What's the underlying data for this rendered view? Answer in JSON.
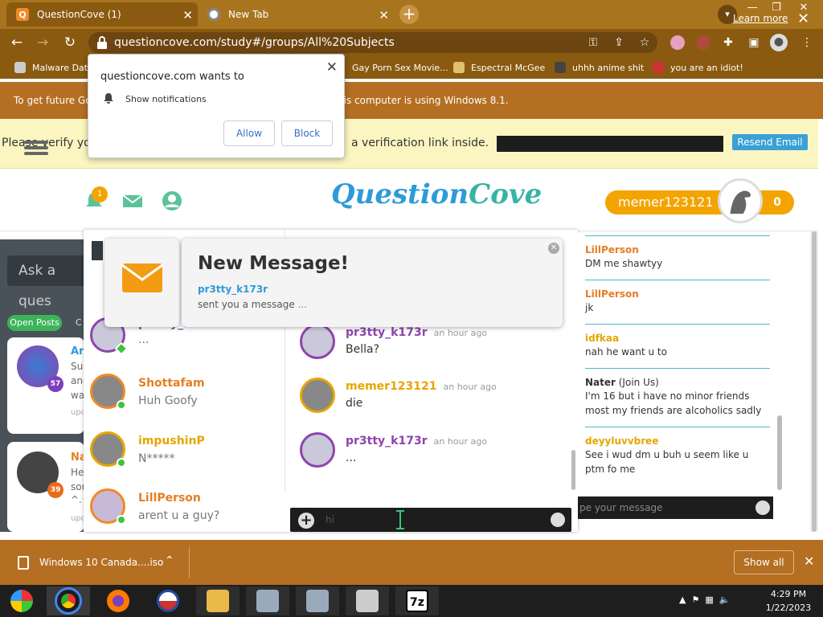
{
  "browser": {
    "tabs": [
      {
        "title": "QuestionCove (1)",
        "active": true
      },
      {
        "title": "New Tab",
        "active": false
      }
    ],
    "new_tab": "+",
    "url": "questioncove.com/study#/groups/All%20Subjects",
    "bookmarks": [
      {
        "label": "Malware Data"
      },
      {
        "label": "Gay Porn Sex Movie..."
      },
      {
        "label": "Espectral McGee"
      },
      {
        "label": "uhhh anime shit"
      },
      {
        "label": "you are an idiot!"
      }
    ]
  },
  "infobar": {
    "text_left": "To get future Go",
    "text_right": "his computer is using Windows 8.1.",
    "learn_more": "Learn more"
  },
  "verify": {
    "text_left": "Please verify yo",
    "text_right": "a verification link inside.",
    "resend": "Resend Email"
  },
  "header": {
    "logo": "Question",
    "logo2": "Cove",
    "notif_count": "1",
    "username": "memer123121",
    "points": "0"
  },
  "left": {
    "ask": "Ask a ques",
    "open_posts": "Open Posts",
    "tab_c": "C",
    "cards": [
      {
        "name": "Ari",
        "lines": [
          "Su",
          "anc",
          "wa"
        ],
        "footer": "upo",
        "badge": "57"
      },
      {
        "name": "Na",
        "lines": [
          "He",
          "sor",
          "^.^"
        ],
        "footer": "upo",
        "badge": "39"
      }
    ]
  },
  "conversations": [
    {
      "name": "pr3tty_k173r",
      "msg": "..."
    },
    {
      "name": "Shottafam",
      "msg": "Huh Goofy"
    },
    {
      "name": "impushinP",
      "msg": "N*****"
    },
    {
      "name": "LillPerson",
      "msg": "arent u a guy?"
    }
  ],
  "messages": [
    {
      "name": "pr3tty_k173r",
      "time": "an hour ago",
      "text": "Bella?",
      "color": "#8e44ad"
    },
    {
      "name": "memer123121",
      "time": "an hour ago",
      "text": "die",
      "color": "#e6a600"
    },
    {
      "name": "pr3tty_k173r",
      "time": "an hour ago",
      "text": "...",
      "color": "#8e44ad"
    }
  ],
  "chat_input": {
    "value": "hi"
  },
  "right_panel": {
    "items": [
      {
        "name": "LillPerson",
        "suffix": "",
        "text": "DM me shawtyy",
        "color": "#e67e22"
      },
      {
        "name": "LillPerson",
        "suffix": "",
        "text": "jk",
        "color": "#e67e22"
      },
      {
        "name": "idfkaa",
        "suffix": "",
        "text": "nah he want u to",
        "color": "#e6a600"
      },
      {
        "name": "Nater",
        "suffix": " (Join Us)",
        "text": "I'm 16 but i have no minor friends most my friends are alcoholics sadly",
        "color": "#333333"
      },
      {
        "name": "deyyluvvbree",
        "suffix": "",
        "text": "See i wud dm u buh u seem like u ptm fo me",
        "color": "#e6a600"
      }
    ],
    "input_placeholder": "pe your message"
  },
  "toast": {
    "title": "New Message!",
    "from": "pr3tty_k173r",
    "body": "sent you a message",
    "ellipsis": "..."
  },
  "permission": {
    "title": "questioncove.com wants to",
    "item": "Show notifications",
    "allow": "Allow",
    "block": "Block"
  },
  "downloads": {
    "file": "Windows 10 Canada....iso",
    "show_all": "Show all"
  },
  "taskbar": {
    "time": "4:29 PM",
    "date": "1/22/2023"
  }
}
